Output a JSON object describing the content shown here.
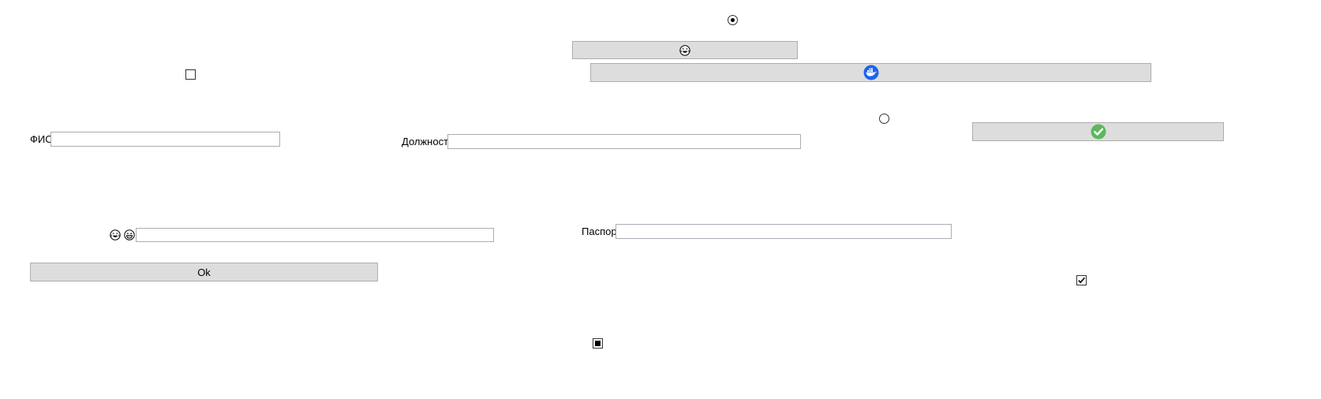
{
  "form": {
    "fio_label": "ФИО",
    "fio_value": "",
    "position_label": "Должность",
    "position_value": "",
    "passport_label": "Паспорт",
    "passport_value": "",
    "emoji_field_value": "",
    "ok_button_label": "Ok"
  },
  "controls": {
    "radio_top": {
      "checked": true
    },
    "radio_mid": {
      "checked": false
    },
    "checkbox_top": {
      "checked": false
    },
    "checkbox_right": {
      "checked": true
    },
    "checkbox_bottom": {
      "state": "indeterminate"
    }
  },
  "icons": {
    "emoji_button_icon": "laughing-face-icon",
    "docker_button_icon": "docker-whale-icon",
    "check_button_icon": "green-checkmark-icon",
    "field_prefix_icons": [
      "laughing-face-icon",
      "grinning-face-icon"
    ]
  },
  "colors": {
    "button_bg": "#dddddd",
    "button_border": "#adadad",
    "docker_blue": "#1d63ed",
    "check_green": "#5cb85c"
  }
}
